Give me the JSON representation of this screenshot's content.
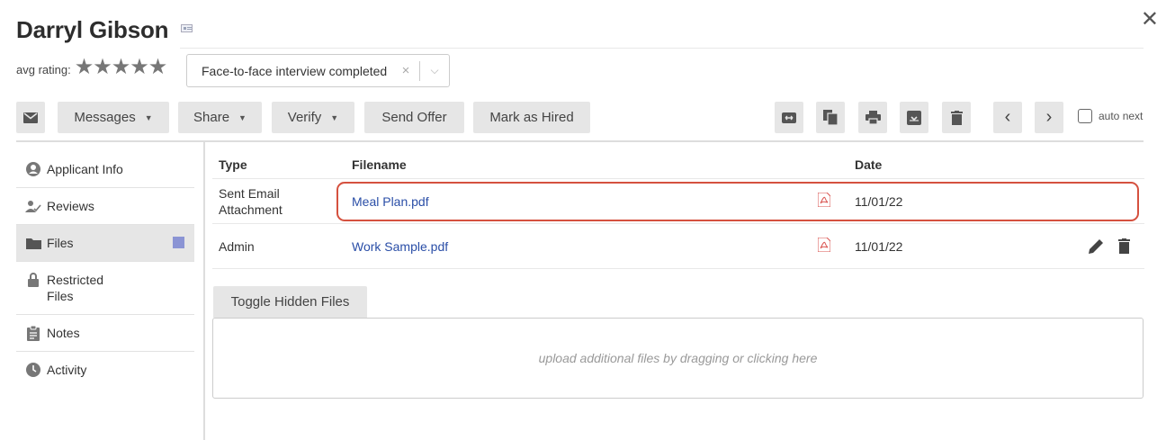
{
  "header": {
    "name": "Darryl Gibson",
    "rating_label": "avg rating:",
    "stars": "★★★★★",
    "close_glyph": "✕"
  },
  "status": {
    "value": "Face-to-face interview completed",
    "clear_glyph": "×",
    "caret_glyph": "⌵"
  },
  "toolbar": {
    "messages": "Messages",
    "share": "Share",
    "verify": "Verify",
    "send_offer": "Send Offer",
    "mark_hired": "Mark as Hired",
    "caret": "▼",
    "prev": "‹",
    "next": "›",
    "auto_next": "auto next"
  },
  "sidebar": {
    "items": [
      {
        "label": "Applicant Info",
        "icon": "user-circle-icon"
      },
      {
        "label": "Reviews",
        "icon": "user-check-icon"
      },
      {
        "label": "Files",
        "icon": "folder-icon"
      },
      {
        "label": "Restricted Files",
        "icon": "lock-icon"
      },
      {
        "label": "Notes",
        "icon": "clipboard-icon"
      },
      {
        "label": "Activity",
        "icon": "clock-icon"
      }
    ]
  },
  "files": {
    "columns": {
      "type": "Type",
      "filename": "Filename",
      "date": "Date"
    },
    "rows": [
      {
        "type": "Sent Email Attachment",
        "filename": "Meal Plan.pdf",
        "date": "11/01/22"
      },
      {
        "type": "Admin",
        "filename": "Work Sample.pdf",
        "date": "11/01/22"
      }
    ],
    "toggle_hidden": "Toggle Hidden Files",
    "dropzone": "upload additional files by dragging or clicking here"
  },
  "colors": {
    "accent_link": "#2a4ea7",
    "highlight": "#d5513f",
    "files_marker": "#8b94d4",
    "pdf_red": "#d9534f"
  }
}
